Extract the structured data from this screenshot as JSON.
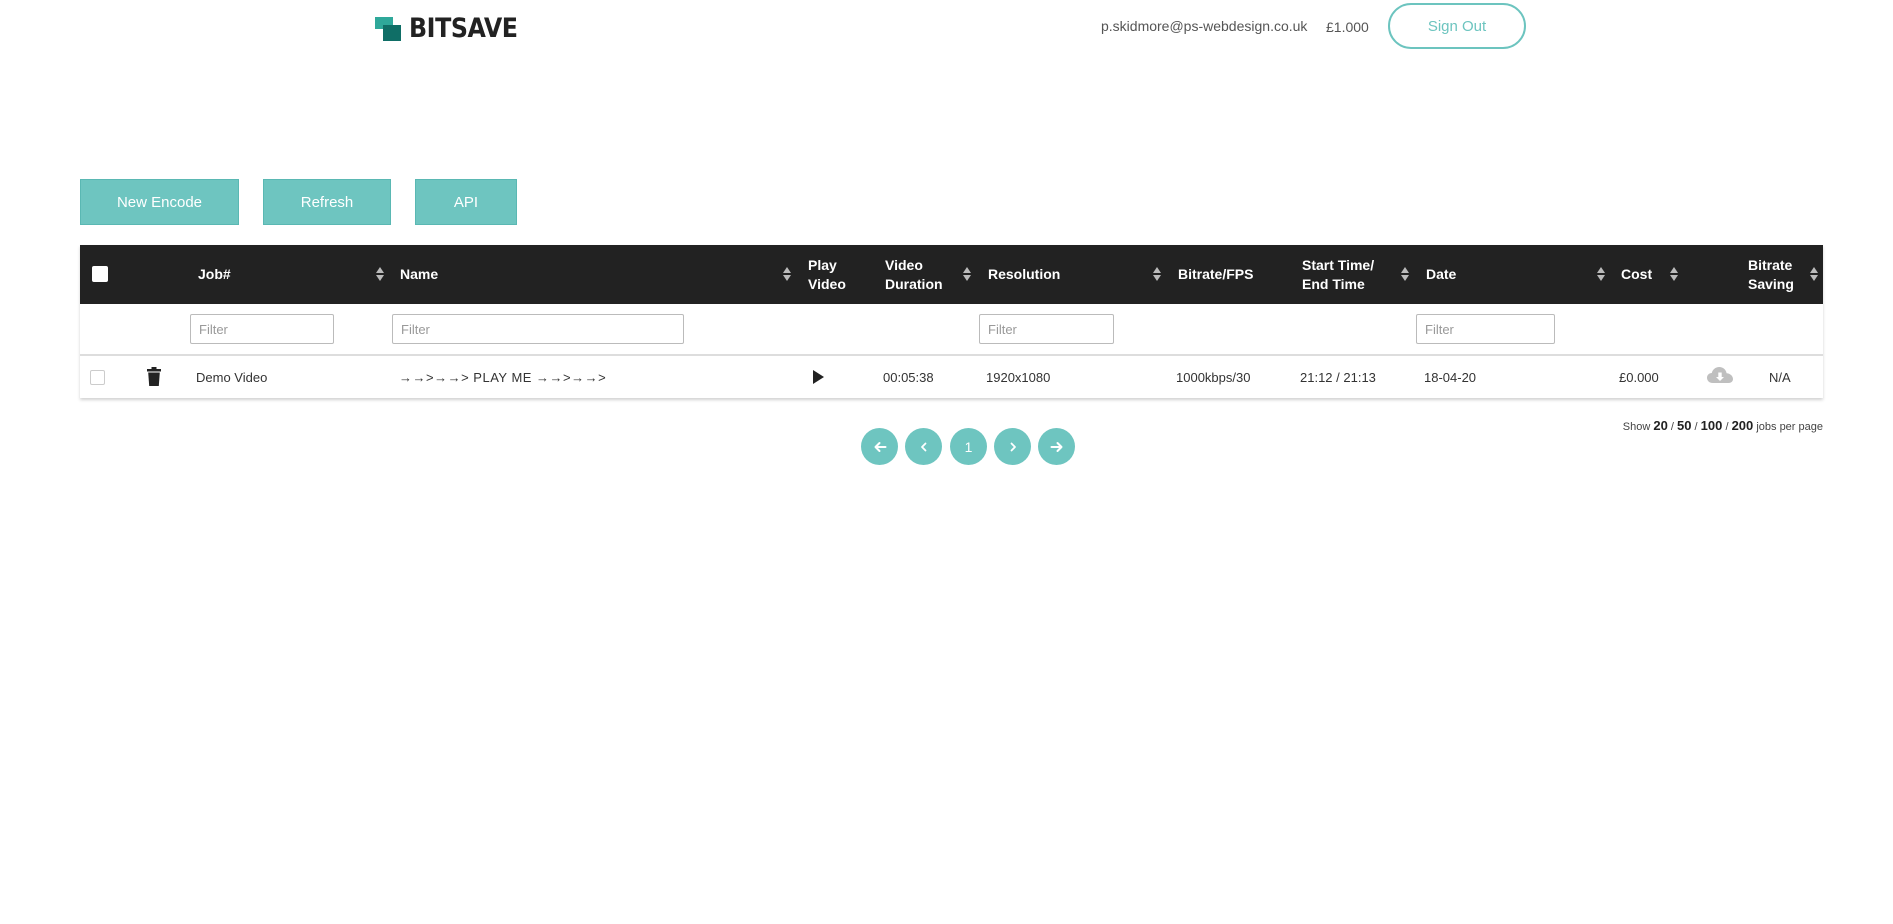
{
  "header": {
    "logo_text": "BITSAVE",
    "user_email": "p.skidmore@ps-webdesign.co.uk",
    "balance": "£1.000",
    "sign_out_label": "Sign Out"
  },
  "actions": {
    "new_encode": "New Encode",
    "refresh": "Refresh",
    "api": "API"
  },
  "table": {
    "columns": {
      "job": "Job#",
      "name": "Name",
      "play_video_1": "Play",
      "play_video_2": "Video",
      "duration_1": "Video",
      "duration_2": "Duration",
      "resolution": "Resolution",
      "bitrate_fps": "Bitrate/FPS",
      "start_end_1": "Start Time/",
      "start_end_2": "End Time",
      "date": "Date",
      "cost": "Cost",
      "saving_1": "Bitrate",
      "saving_2": "Saving"
    },
    "filter_placeholder": "Filter",
    "rows": [
      {
        "job": "Demo Video",
        "name": "→→>→→> PLAY ME →→>→→>",
        "duration": "00:05:38",
        "resolution": "1920x1080",
        "bitrate_fps": "1000kbps/30",
        "start_end": "21:12 / 21:13",
        "date": "18-04-20",
        "cost": "£0.000",
        "saving": "N/A"
      }
    ]
  },
  "pagination": {
    "first_icon": "arrow-left-icon",
    "prev_icon": "chevron-left-icon",
    "current_page": "1",
    "next_icon": "chevron-right-icon",
    "last_icon": "arrow-right-icon",
    "show_label": "Show",
    "sizes": [
      "20",
      "50",
      "100",
      "200"
    ],
    "separator": "/",
    "suffix": "jobs per page"
  },
  "colors": {
    "accent": "#6ec5c0",
    "header_bg": "#222222",
    "logo_light": "#2fa89a",
    "logo_dark": "#0f6e66"
  },
  "icons": [
    "trash-icon",
    "play-icon",
    "cloud-download-icon",
    "sort-icon"
  ]
}
